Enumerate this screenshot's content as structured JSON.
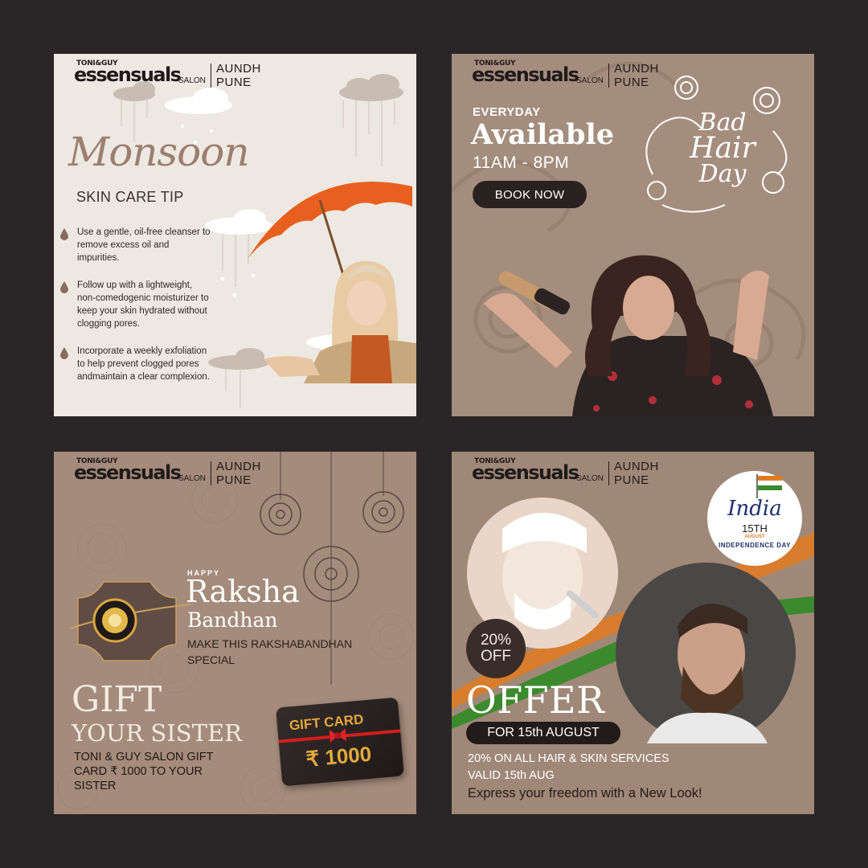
{
  "brand": {
    "toni_guy": "TONI&GUY",
    "name": "essensuals",
    "salon": "SALON",
    "location_line1": "AUNDH",
    "location_line2": "PUNE"
  },
  "monsoon": {
    "title": "Monsoon",
    "subtitle": "SKIN CARE TIP",
    "tips": [
      "Use a gentle, oil-free cleanser to remove excess oil and impurities.",
      "Follow up with a lightweight, non-comedogenic moisturizer to keep your skin hydrated without clogging pores.",
      "Incorporate a weekly exfoliation to help prevent clogged pores andmaintain a clear complexion."
    ],
    "colors": {
      "bg": "#ede8e2",
      "umbrella": "#e8601f",
      "title": "#9c7f6f"
    }
  },
  "bad_hair": {
    "everyday": "EVERYDAY",
    "available": "Available",
    "hours": "11AM - 8PM",
    "cta": "BOOK NOW",
    "script_line1": "Bad",
    "script_line2": "Hair",
    "script_line3": "Day",
    "colors": {
      "bg": "#a58d7e",
      "button": "#2a2220"
    }
  },
  "raksha": {
    "happy": "HAPPY",
    "title": "Raksha",
    "subtitle": "Bandhan",
    "tagline": "MAKE THIS RAKSHABANDHAN SPECIAL",
    "gift_line1": "GIFT",
    "gift_line2": "YOUR SISTER",
    "gift_desc": "TONI & GUY SALON GIFT CARD ₹ 1000 TO YOUR SISTER",
    "card_title": "GIFT CARD",
    "card_amount": "₹ 1000",
    "colors": {
      "bg": "#a48b7b",
      "gold": "#e2a83d",
      "ribbon": "#d31d20"
    }
  },
  "india": {
    "badge_script": "India",
    "badge_date": "15TH",
    "badge_month": "AUGUST",
    "badge_text": "INDEPENDENCE DAY",
    "discount_pct": "20%",
    "discount_off": "OFF",
    "offer": "OFFER",
    "offer_date": "FOR 15th AUGUST",
    "services_line1": "20% ON ALL HAIR & SKIN SERVICES",
    "services_line2": "VALID 15th AUG",
    "freedom": "Express your freedom with a New Look!",
    "colors": {
      "saffron": "#e07b20",
      "green": "#3b8a2d",
      "navy": "#1d2f6b"
    }
  }
}
